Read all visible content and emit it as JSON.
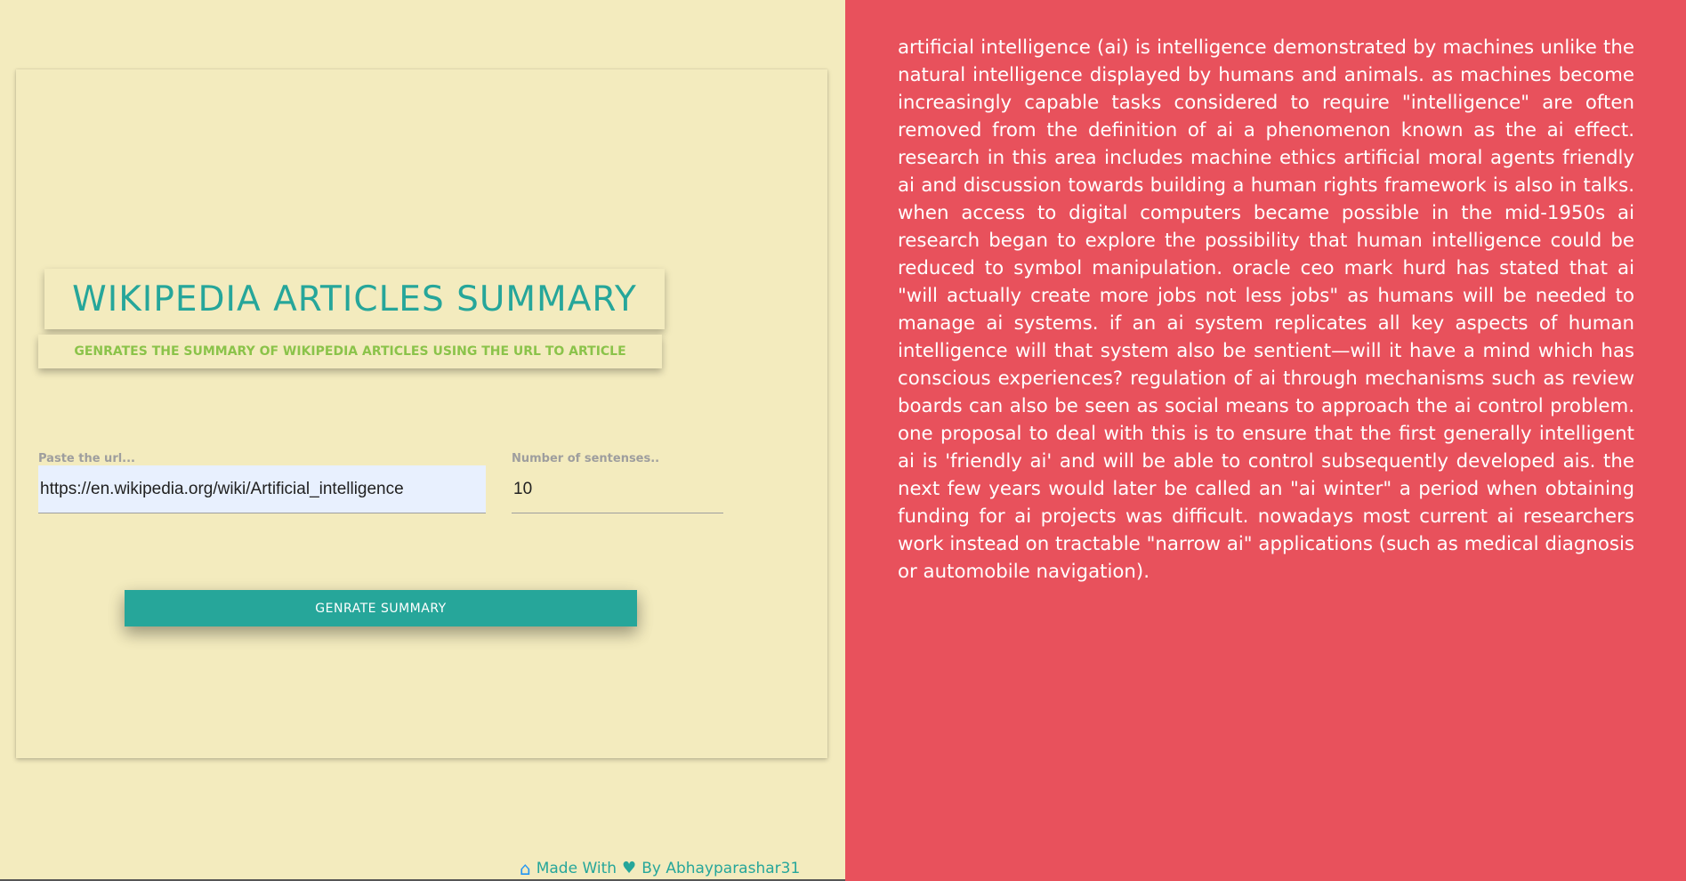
{
  "app": {
    "title": "WIKIPEDIA ARTICLES SUMMARY",
    "subtitle": "GENRATES THE SUMMARY OF WIKIPEDIA ARTICLES USING THE URL TO ARTICLE"
  },
  "form": {
    "url_label": "Paste the url...",
    "url_value": "https://en.wikipedia.org/wiki/Artificial_intelligence",
    "count_label": "Number of sentenses..",
    "count_value": "10",
    "button_label": "GENRATE SUMMARY"
  },
  "footer": {
    "made_with": "Made With",
    "by_text": "By Abhayparashar31",
    "home_icon": "home-icon",
    "heart_icon": "heart-icon"
  },
  "summary": {
    "text": "artificial intelligence (ai) is intelligence demonstrated by machines unlike the natural intelligence displayed by humans and animals. as machines become increasingly capable tasks considered to require \"intelligence\" are often removed from the definition of ai a phenomenon known as the ai effect. research in this area includes machine ethics artificial moral agents friendly ai and discussion towards building a human rights framework is also in talks. when access to digital computers became possible in the mid-1950s ai research began to explore the possibility that human intelligence could be reduced to symbol manipulation. oracle ceo mark hurd has stated that ai \"will actually create more jobs not less jobs\" as humans will be needed to manage ai systems. if an ai system replicates all key aspects of human intelligence will that system also be sentient—will it have a mind which has conscious experiences? regulation of ai through mechanisms such as review boards can also be seen as social means to approach the ai control problem. one proposal to deal with this is to ensure that the first generally intelligent ai is 'friendly ai' and will be able to control subsequently developed ais. the next few years would later be called an \"ai winter\" a period when obtaining funding for ai projects was difficult. nowadays most current ai researchers work instead on tractable \"narrow ai\" applications (such as medical diagnosis or automobile navigation)."
  },
  "colors": {
    "left_background": "#f3ebbe",
    "right_background": "#e8515c",
    "accent_teal": "#26a69a",
    "subtitle_green": "#8bc34a",
    "home_icon_blue": "#2196f3"
  }
}
